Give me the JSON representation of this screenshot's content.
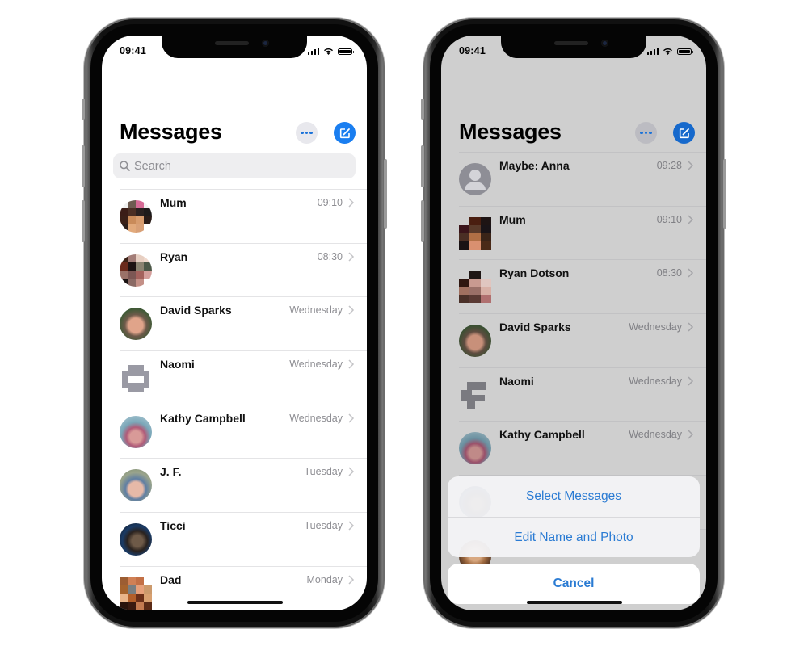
{
  "colors": {
    "accent": "#1a7ef0",
    "action_text": "#2a7bd3",
    "secondary_text": "#8e8e93"
  },
  "phones": [
    {
      "status": {
        "time": "09:41",
        "icons": [
          "signal-icon",
          "wifi-icon",
          "battery-icon"
        ]
      },
      "header": {
        "title": "Messages",
        "more_icon": "ellipsis-icon",
        "compose_icon": "compose-icon"
      },
      "search": {
        "placeholder": "Search",
        "icon": "search-icon"
      },
      "conversations": [
        {
          "name": "Mum",
          "time": "09:10",
          "avatar": "pixelated-photo"
        },
        {
          "name": "Ryan",
          "time": "08:30",
          "avatar": "pixelated-photo"
        },
        {
          "name": "David Sparks",
          "time": "Wednesday",
          "avatar": "photo"
        },
        {
          "name": "Naomi",
          "time": "Wednesday",
          "avatar": "pixelated-glyph"
        },
        {
          "name": "Kathy Campbell",
          "time": "Wednesday",
          "avatar": "photo"
        },
        {
          "name": "J. F.",
          "time": "Tuesday",
          "avatar": "photo"
        },
        {
          "name": "Ticci",
          "time": "Tuesday",
          "avatar": "photo"
        },
        {
          "name": "Dad",
          "time": "Monday",
          "avatar": "pixelated-photo"
        }
      ]
    },
    {
      "status": {
        "time": "09:41",
        "icons": [
          "signal-icon",
          "wifi-icon",
          "battery-icon"
        ]
      },
      "header": {
        "title": "Messages",
        "more_icon": "ellipsis-icon",
        "compose_icon": "compose-icon"
      },
      "conversations": [
        {
          "name": "Maybe: Anna",
          "time": "09:28",
          "avatar": "default-person"
        },
        {
          "name": "Mum",
          "time": "09:10",
          "avatar": "pixelated-photo"
        },
        {
          "name": "Ryan Dotson",
          "time": "08:30",
          "avatar": "pixelated-photo"
        },
        {
          "name": "David Sparks",
          "time": "Wednesday",
          "avatar": "photo"
        },
        {
          "name": "Naomi",
          "time": "Wednesday",
          "avatar": "pixelated-glyph"
        },
        {
          "name": "Kathy Campbell",
          "time": "Wednesday",
          "avatar": "photo"
        }
      ],
      "action_sheet": {
        "actions": [
          "Select Messages",
          "Edit Name and Photo"
        ],
        "cancel": "Cancel"
      }
    }
  ]
}
